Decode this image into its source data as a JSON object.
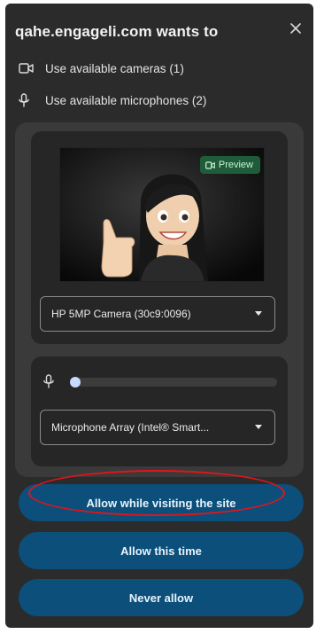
{
  "dialog": {
    "title": "qahe.engageli.com wants to",
    "close_label": "×"
  },
  "permissions": [
    {
      "icon": "camera-icon",
      "label": "Use available cameras (1)"
    },
    {
      "icon": "microphone-icon",
      "label": "Use available microphones (2)"
    }
  ],
  "camera": {
    "preview_label": "Preview",
    "selected": "HP 5MP Camera (30c9:0096)"
  },
  "microphone": {
    "selected": "Microphone Array (Intel® Smart...",
    "level": 0.0
  },
  "buttons": {
    "allow_while_visiting": "Allow while visiting the site",
    "allow_this_time": "Allow this time",
    "never_allow": "Never allow"
  },
  "colors": {
    "dialog_bg": "#2b2b2b",
    "button_bg": "#0b4f7a",
    "highlight": "#e0151b",
    "preview_badge": "#1f5c3a"
  }
}
